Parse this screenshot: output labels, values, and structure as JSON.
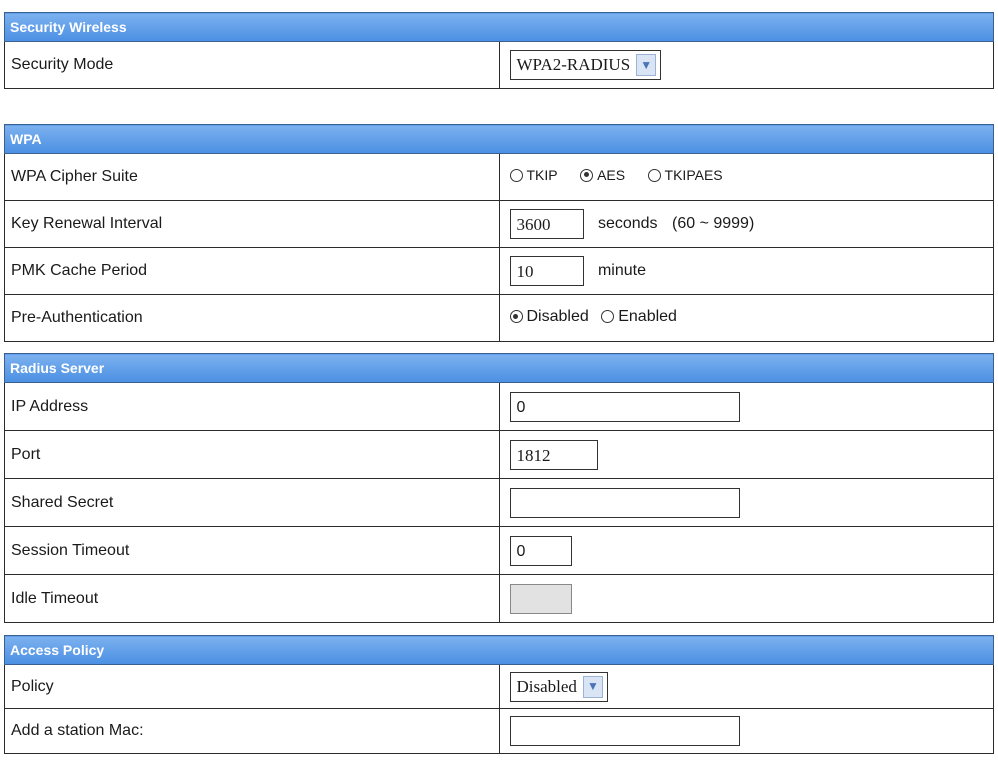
{
  "sections": {
    "security_wireless": {
      "title": "Security Wireless",
      "security_mode": {
        "label": "Security Mode",
        "value": "WPA2-RADIUS"
      }
    },
    "wpa": {
      "title": "WPA",
      "cipher_suite": {
        "label": "WPA Cipher Suite",
        "options": [
          "TKIP",
          "AES",
          "TKIPAES"
        ],
        "selected": "AES"
      },
      "key_renewal": {
        "label": "Key Renewal Interval",
        "value": "3600",
        "unit": "seconds",
        "range": "(60 ~ 9999)"
      },
      "pmk_cache": {
        "label": "PMK Cache Period",
        "value": "10",
        "unit": "minute"
      },
      "pre_auth": {
        "label": "Pre-Authentication",
        "options": [
          "Disabled",
          "Enabled"
        ],
        "selected": "Disabled"
      }
    },
    "radius_server": {
      "title": "Radius Server",
      "ip_address": {
        "label": "IP Address",
        "value": "0"
      },
      "port": {
        "label": "Port",
        "value": "1812"
      },
      "shared_secret": {
        "label": "Shared Secret",
        "value": ""
      },
      "session_timeout": {
        "label": "Session Timeout",
        "value": "0"
      },
      "idle_timeout": {
        "label": "Idle Timeout",
        "value": ""
      }
    },
    "access_policy": {
      "title": "Access Policy",
      "policy": {
        "label": "Policy",
        "value": "Disabled"
      },
      "add_station": {
        "label": "Add a station Mac:",
        "value": ""
      }
    }
  },
  "colors": {
    "header_bg": "#5a9be8",
    "header_text": "#ffffff",
    "border": "#2b2b2b"
  },
  "icons": {
    "dropdown": "chevron-down-icon",
    "radio": "radio-icon"
  }
}
